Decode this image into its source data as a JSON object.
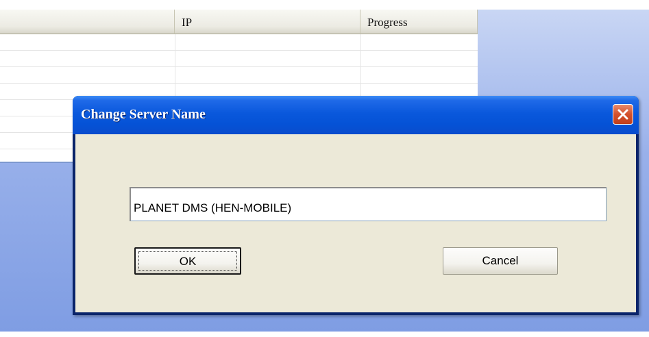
{
  "list": {
    "columns": [
      "",
      "IP",
      "Progress"
    ],
    "rows": 7
  },
  "dialog": {
    "title": "Change Server Name",
    "server_name_value": "PLANET DMS (HEN-MOBILE)",
    "ok_label": "OK",
    "cancel_label": "Cancel",
    "close_icon": "close-icon"
  },
  "colors": {
    "title_bar": "#0a58dc",
    "close_button": "#d3502b",
    "dialog_face": "#ece9d8",
    "desktop": "#98b0ea"
  }
}
